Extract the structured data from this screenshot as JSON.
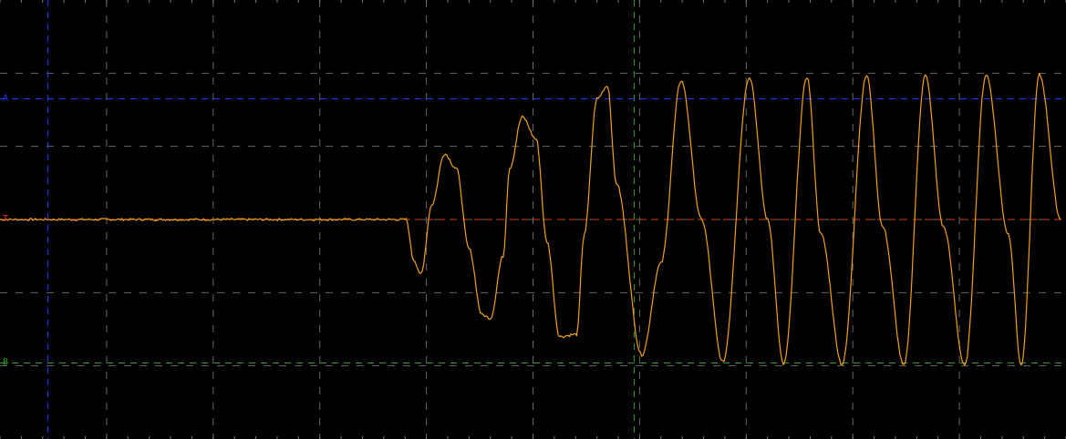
{
  "chart_data": {
    "type": "line",
    "title": "",
    "xlabel": "",
    "ylabel": "",
    "grid": true,
    "grid_divisions": {
      "x": 10,
      "y": 6
    },
    "xlim": [
      0,
      10
    ],
    "ylim": [
      -3,
      3
    ],
    "colors": {
      "background": "#000000",
      "grid": "#7a7a7a",
      "trace": "#f0a020",
      "trigger_line": "#e03a10",
      "cursor_a": "#1a3cff",
      "cursor_b": "#2aa02a",
      "time_cursor_1": "#1a3cff",
      "time_cursor_2": "#2aa02a"
    },
    "cursors": {
      "horizontal": [
        {
          "id": "A",
          "label": "A",
          "y": 1.65,
          "color": "#1a3cff"
        },
        {
          "id": "T",
          "label": "T",
          "y": 0.0,
          "color": "#e03a10"
        },
        {
          "id": "B",
          "label": "B",
          "y": -1.96,
          "color": "#2aa02a"
        }
      ],
      "vertical": [
        {
          "id": "v1",
          "x": 0.45,
          "color": "#1a3cff"
        },
        {
          "id": "v2",
          "x": 5.95,
          "color": "#2aa02a"
        }
      ]
    },
    "series": [
      {
        "color": "#f0a020",
        "x": [
          0.0,
          3.81,
          3.88,
          3.95,
          4.05,
          4.17,
          4.28,
          4.4,
          4.52,
          4.6,
          4.72,
          4.78,
          4.9,
          5.03,
          5.13,
          5.25,
          5.41,
          5.48,
          5.6,
          5.7,
          5.78,
          6.02,
          6.2,
          6.39,
          6.58,
          6.78,
          7.03,
          7.2,
          7.35,
          7.57,
          7.7,
          7.9,
          8.13,
          8.28,
          8.48,
          8.68,
          8.85,
          9.05,
          9.25,
          9.46,
          9.58,
          9.75,
          9.95
        ],
        "y": [
          0.0,
          0.0,
          -0.55,
          -0.75,
          0.2,
          0.9,
          0.7,
          -0.4,
          -1.3,
          -1.35,
          -0.5,
          0.7,
          1.4,
          1.1,
          -0.3,
          -1.6,
          -1.57,
          -0.2,
          1.65,
          1.83,
          0.5,
          -1.85,
          -0.6,
          1.9,
          0.0,
          -1.95,
          1.95,
          0.0,
          -1.98,
          1.95,
          -0.2,
          -1.98,
          1.97,
          -0.1,
          -2.0,
          1.97,
          -0.1,
          -2.0,
          1.98,
          -0.2,
          -2.0,
          1.98,
          0.0
        ]
      }
    ]
  }
}
